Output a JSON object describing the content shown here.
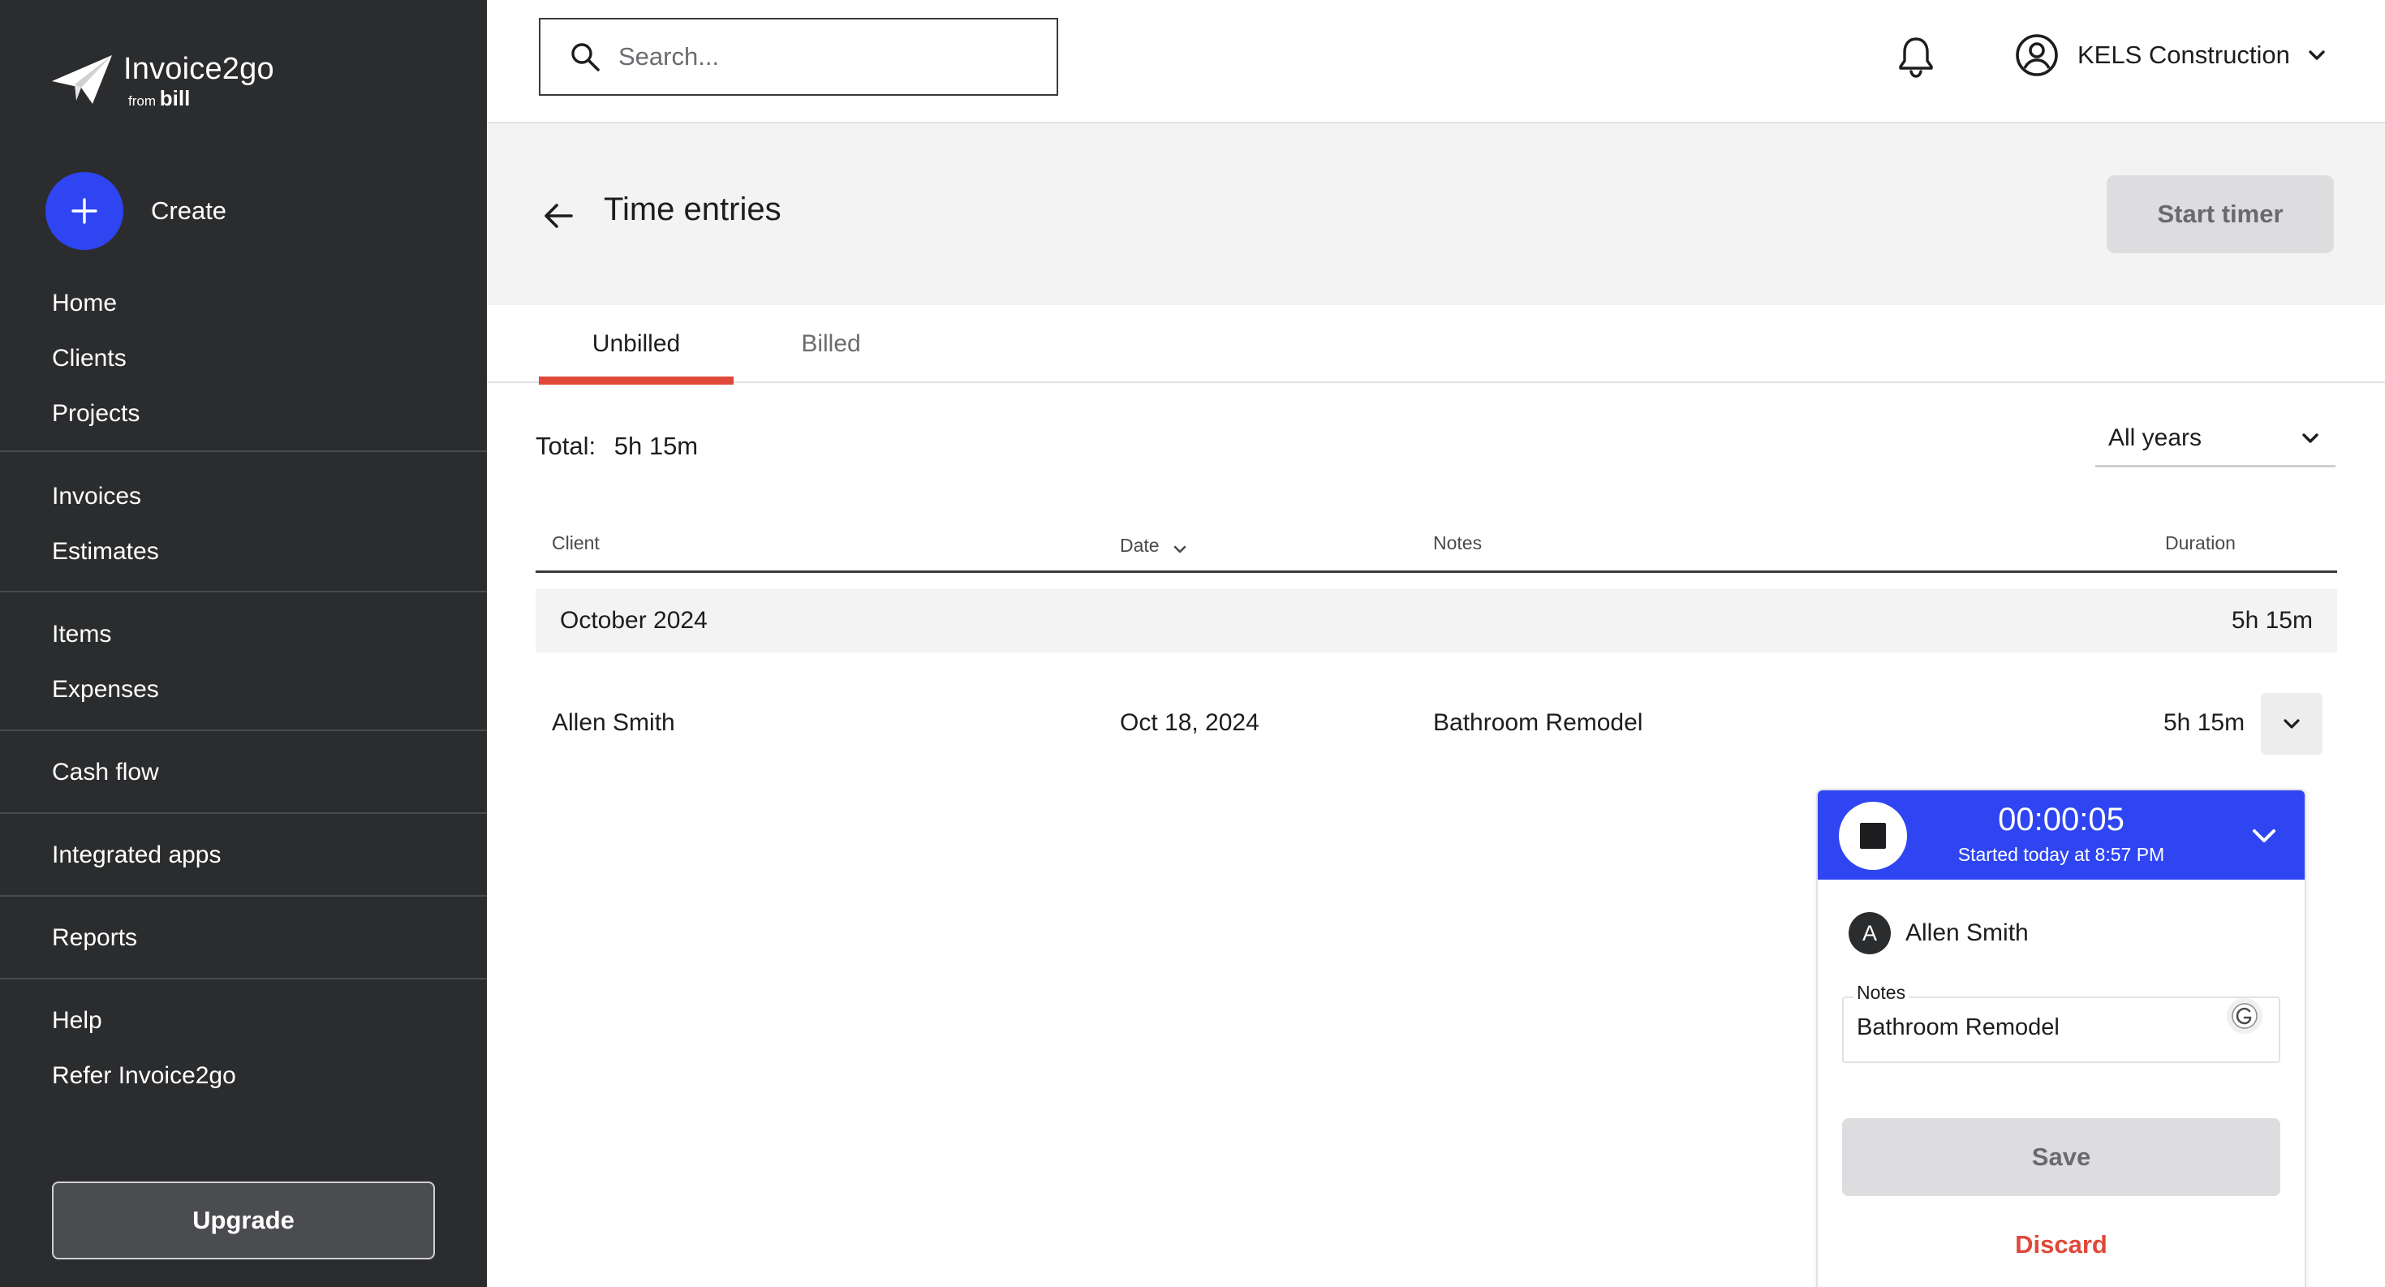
{
  "brand": {
    "name": "Invoice2go",
    "sub_prefix": "from",
    "sub_brand": "bill"
  },
  "sidebar": {
    "create_label": "Create",
    "groups": [
      [
        "Home",
        "Clients",
        "Projects"
      ],
      [
        "Invoices",
        "Estimates"
      ],
      [
        "Items",
        "Expenses"
      ],
      [
        "Cash flow"
      ],
      [
        "Integrated apps"
      ],
      [
        "Reports"
      ],
      [
        "Help",
        "Refer Invoice2go"
      ]
    ],
    "upgrade_label": "Upgrade"
  },
  "topbar": {
    "search_placeholder": "Search...",
    "account_name": "KELS Construction",
    "icons": [
      "search-icon",
      "bell-icon",
      "user-circle-icon",
      "chevron-down-icon"
    ]
  },
  "header": {
    "title": "Time entries",
    "start_timer_label": "Start timer"
  },
  "tabs": {
    "items": [
      "Unbilled",
      "Billed"
    ],
    "active": "Unbilled"
  },
  "summary": {
    "total_label": "Total:",
    "total_value": "5h 15m",
    "year_filter": "All years"
  },
  "table": {
    "headers": {
      "client": "Client",
      "date": "Date",
      "notes": "Notes",
      "duration": "Duration"
    },
    "groups": [
      {
        "label": "October 2024",
        "total": "5h 15m",
        "rows": [
          {
            "client": "Allen Smith",
            "date": "Oct 18, 2024",
            "notes": "Bathroom Remodel",
            "duration": "5h 15m"
          }
        ]
      }
    ]
  },
  "timer": {
    "elapsed": "00:00:05",
    "started": "Started today at 8:57 PM",
    "client_initial": "A",
    "client_name": "Allen Smith",
    "notes_label": "Notes",
    "notes_value": "Bathroom Remodel",
    "save_label": "Save",
    "discard_label": "Discard"
  },
  "colors": {
    "sidebar_bg": "#2b2c2e",
    "accent_blue": "#2f45f2",
    "active_tab_underline": "#e0483a",
    "discard_red": "#e0483a"
  }
}
